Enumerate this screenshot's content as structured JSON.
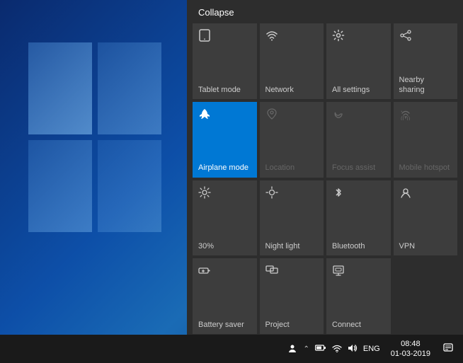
{
  "desktop": {
    "background_desc": "Windows 10 blue desktop background"
  },
  "action_center": {
    "collapse_label": "Collapse",
    "tiles": [
      {
        "id": "tablet-mode",
        "label": "Tablet mode",
        "icon": "⊞",
        "active": false,
        "dimmed": false,
        "icon_unicode": "▭"
      },
      {
        "id": "network",
        "label": "Network",
        "icon": "wifi",
        "active": false,
        "dimmed": false
      },
      {
        "id": "all-settings",
        "label": "All settings",
        "icon": "gear",
        "active": false,
        "dimmed": false
      },
      {
        "id": "nearby-sharing",
        "label": "Nearby sharing",
        "icon": "share",
        "active": false,
        "dimmed": false
      },
      {
        "id": "airplane-mode",
        "label": "Airplane mode",
        "icon": "plane",
        "active": true,
        "dimmed": false
      },
      {
        "id": "location",
        "label": "Location",
        "icon": "person",
        "active": false,
        "dimmed": true
      },
      {
        "id": "focus-assist",
        "label": "Focus assist",
        "icon": "moon",
        "active": false,
        "dimmed": true
      },
      {
        "id": "mobile-hotspot",
        "label": "Mobile hotspot",
        "icon": "hotspot",
        "active": false,
        "dimmed": true
      },
      {
        "id": "brightness",
        "label": "30%",
        "icon": "sun",
        "active": false,
        "dimmed": false
      },
      {
        "id": "night-light",
        "label": "Night light",
        "icon": "sun2",
        "active": false,
        "dimmed": false
      },
      {
        "id": "bluetooth",
        "label": "Bluetooth",
        "icon": "bluetooth",
        "active": false,
        "dimmed": false
      },
      {
        "id": "vpn",
        "label": "VPN",
        "icon": "vpn",
        "active": false,
        "dimmed": false
      },
      {
        "id": "battery-saver",
        "label": "Battery saver",
        "icon": "battery",
        "active": false,
        "dimmed": false
      },
      {
        "id": "project",
        "label": "Project",
        "icon": "project",
        "active": false,
        "dimmed": false
      },
      {
        "id": "connect",
        "label": "Connect",
        "icon": "connect",
        "active": false,
        "dimmed": false
      }
    ]
  },
  "taskbar": {
    "sys_tray": {
      "people_icon": "👤",
      "chevron": "^",
      "battery_icon": "🔋",
      "network_icon": "↕",
      "volume_icon": "🔊",
      "language": "ENG"
    },
    "clock": {
      "time": "08:48",
      "date": "01-03-2019"
    },
    "notification_icon": "💬"
  }
}
